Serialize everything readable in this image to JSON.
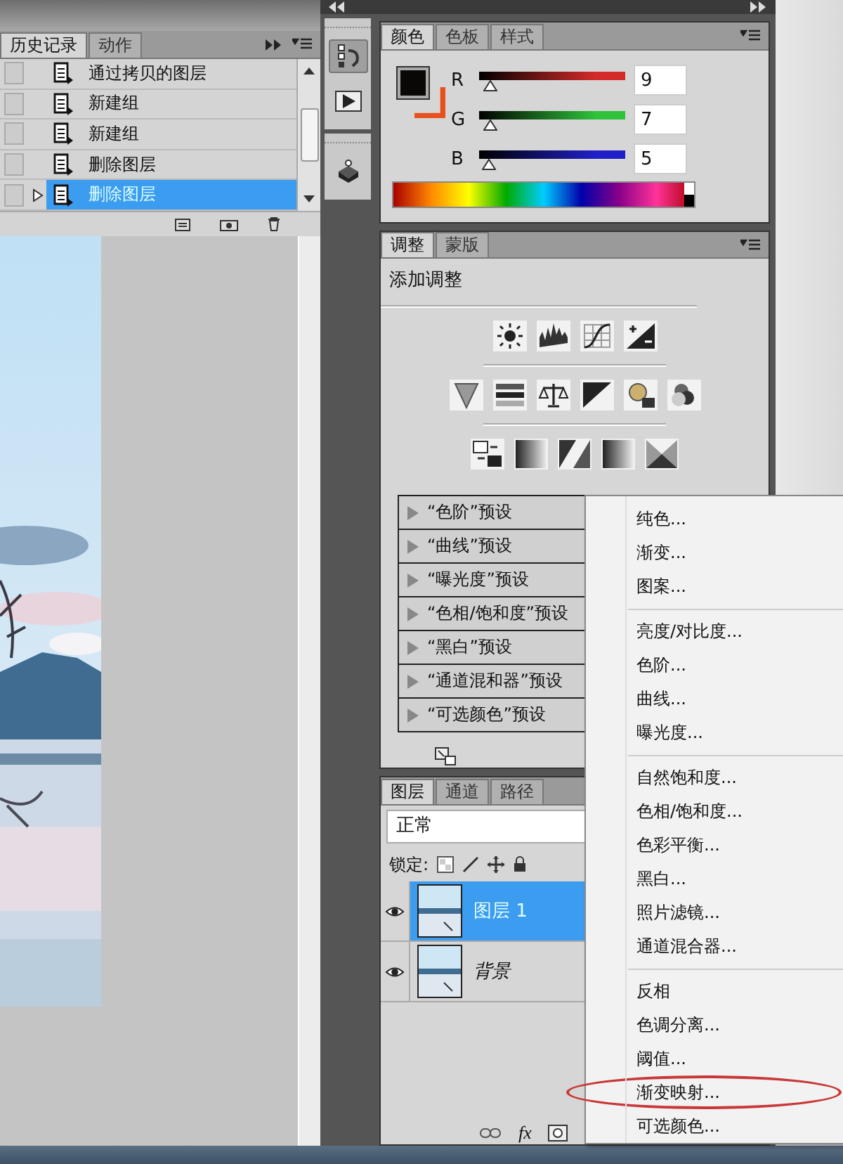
{
  "history_panel": {
    "tabs": [
      {
        "label": "历史记录",
        "selected": true
      },
      {
        "label": "动作",
        "selected": false
      }
    ],
    "states": [
      {
        "label": "通过拷贝的图层",
        "selected": false,
        "snapshot": false
      },
      {
        "label": "新建组",
        "selected": false,
        "snapshot": false
      },
      {
        "label": "新建组",
        "selected": false,
        "snapshot": false
      },
      {
        "label": "删除图层",
        "selected": false,
        "snapshot": false
      },
      {
        "label": "删除图层",
        "selected": true,
        "snapshot": false
      }
    ]
  },
  "color_panel": {
    "tabs": [
      {
        "label": "颜色",
        "selected": true
      },
      {
        "label": "色板",
        "selected": false
      },
      {
        "label": "样式",
        "selected": false
      }
    ],
    "swatches": [
      {
        "kind": "foreground",
        "color": "#0a0806"
      },
      {
        "kind": "background",
        "color": "#e8501e"
      }
    ],
    "channels": [
      {
        "name": "R",
        "value": "9",
        "level": 0.035,
        "color": "#d42a2a"
      },
      {
        "name": "G",
        "value": "7",
        "level": 0.027,
        "color": "#2fc23a"
      },
      {
        "name": "B",
        "value": "5",
        "level": 0.02,
        "color": "#2020c8"
      }
    ]
  },
  "adjustments_panel": {
    "tabs": [
      {
        "label": "调整",
        "selected": true
      },
      {
        "label": "蒙版",
        "selected": false
      }
    ],
    "heading": "添加调整",
    "presets": [
      "“色阶”预设",
      "“曲线”预设",
      "“曝光度”预设",
      "“色相/饱和度”预设",
      "“黑白”预设",
      "“通道混和器”预设",
      "“可选颜色”预设"
    ]
  },
  "layers_panel": {
    "tabs": [
      {
        "label": "图层",
        "selected": true
      },
      {
        "label": "通道",
        "selected": false
      },
      {
        "label": "路径",
        "selected": false
      }
    ],
    "blend_mode": "正常",
    "lock_label": "锁定:",
    "layers": [
      {
        "name": "图层 1",
        "kind": "layer",
        "selected": true,
        "visible": true
      },
      {
        "name": "背景",
        "kind": "background",
        "selected": false,
        "visible": true
      }
    ],
    "footer_label": "fx"
  },
  "context_menu": {
    "groups": [
      [
        {
          "label": "纯色...",
          "circled": false
        },
        {
          "label": "渐变...",
          "circled": false
        },
        {
          "label": "图案...",
          "circled": false
        }
      ],
      [
        {
          "label": "亮度/对比度...",
          "circled": false
        },
        {
          "label": "色阶...",
          "circled": false
        },
        {
          "label": "曲线...",
          "circled": false
        },
        {
          "label": "曝光度...",
          "circled": false
        }
      ],
      [
        {
          "label": "自然饱和度...",
          "circled": false
        },
        {
          "label": "色相/饱和度...",
          "circled": false
        },
        {
          "label": "色彩平衡...",
          "circled": false
        },
        {
          "label": "黑白...",
          "circled": false
        },
        {
          "label": "照片滤镜...",
          "circled": false
        },
        {
          "label": "通道混合器...",
          "circled": false
        }
      ],
      [
        {
          "label": "反相",
          "circled": false
        },
        {
          "label": "色调分离...",
          "circled": false
        },
        {
          "label": "阈值...",
          "circled": false
        },
        {
          "label": "渐变映射...",
          "circled": true
        },
        {
          "label": "可选颜色...",
          "circled": false
        }
      ]
    ]
  }
}
